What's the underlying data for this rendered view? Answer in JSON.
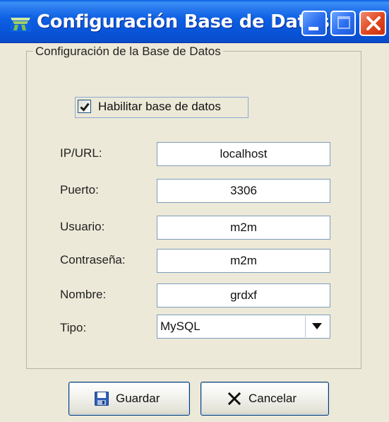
{
  "window": {
    "title": "Configuración Base de Datos",
    "icon": "app-logo-icon",
    "controls": [
      "minimize-icon",
      "maximize-icon",
      "close-icon"
    ],
    "accent_color": "#0a5ee0",
    "close_color": "#e0461f"
  },
  "group": {
    "title": "Configuración de la Base de Datos"
  },
  "enable_checkbox": {
    "label": "Habilitar base de datos",
    "checked": true
  },
  "fields": {
    "ip": {
      "label": "IP/URL:",
      "value": "localhost"
    },
    "port": {
      "label": "Puerto:",
      "value": "3306"
    },
    "user": {
      "label": "Usuario:",
      "value": "m2m"
    },
    "password": {
      "label": "Contraseña:",
      "value": "m2m"
    },
    "name": {
      "label": "Nombre:",
      "value": "grdxf"
    },
    "type": {
      "label": "Tipo:",
      "value": "MySQL"
    }
  },
  "buttons": {
    "save": {
      "label": "Guardar",
      "icon": "floppy-disk-icon"
    },
    "cancel": {
      "label": "Cancelar",
      "icon": "x-cancel-icon"
    }
  }
}
